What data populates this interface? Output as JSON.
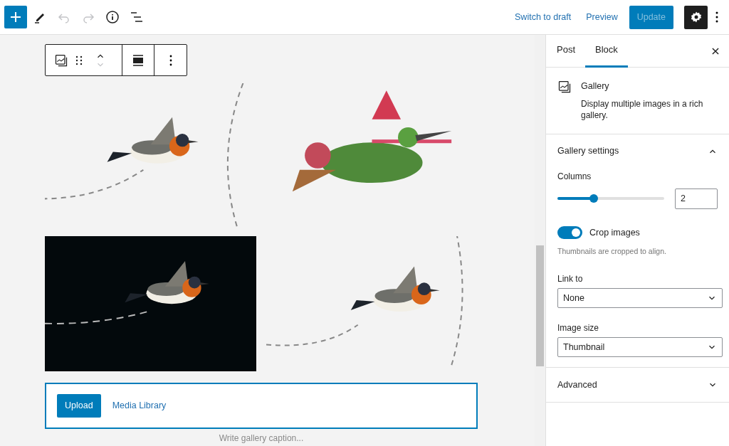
{
  "header": {
    "tools": [
      {
        "kind": "add",
        "disabled": false
      },
      {
        "kind": "edit",
        "disabled": false
      },
      {
        "kind": "undo",
        "disabled": true
      },
      {
        "kind": "redo",
        "disabled": true
      },
      {
        "kind": "info",
        "disabled": false
      },
      {
        "kind": "list",
        "disabled": false
      }
    ],
    "switch_to_draft": "Switch to draft",
    "preview": "Preview",
    "update": {
      "label": "Update",
      "disabled": true
    },
    "settings_selected": true
  },
  "block_toolbar": {
    "moves": [
      {
        "kind": "up",
        "disabled": false
      },
      {
        "kind": "down",
        "disabled": true
      }
    ]
  },
  "gallery": {
    "upload": "Upload",
    "media_library": "Media Library",
    "caption_placeholder": "Write gallery caption..."
  },
  "sidebar": {
    "tabs": [
      {
        "label": "Post",
        "selected": false
      },
      {
        "label": "Block",
        "selected": true
      }
    ],
    "block": {
      "title": "Gallery",
      "description": "Display multiple images in a rich gallery."
    },
    "panels": [
      {
        "title": "Gallery settings",
        "expanded": true
      },
      {
        "title": "Advanced",
        "expanded": false
      }
    ],
    "columns": {
      "label": "Columns",
      "level": 0.34,
      "value": "2"
    },
    "crop": {
      "label": "Crop images",
      "on": true,
      "help": "Thumbnails are cropped to align."
    },
    "link_to": {
      "label": "Link to",
      "value": "None"
    },
    "image_size": {
      "label": "Image size",
      "value": "Thumbnail"
    }
  }
}
